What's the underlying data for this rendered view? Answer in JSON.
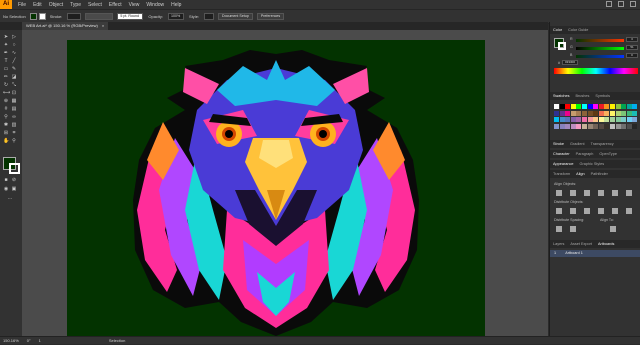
{
  "app": {
    "logo": "Ai"
  },
  "menu": {
    "items": [
      "File",
      "Edit",
      "Object",
      "Type",
      "Select",
      "Effect",
      "View",
      "Window",
      "Help"
    ]
  },
  "control_bar": {
    "selection_label": "No Selection",
    "stroke_label": "Stroke:",
    "brush_value": "5 pt. Round",
    "opacity_label": "Opacity:",
    "opacity_value": "100%",
    "style_label": "Style:",
    "document_setup": "Document Setup",
    "preferences": "Preferences",
    "fill_color": "#033300",
    "stroke_color": "#ffffff"
  },
  "document_tab": {
    "title": "WEB Art.ai* @ 150.16 % (RGB/Preview)",
    "close": "×"
  },
  "status_bar": {
    "zoom": "150.16%",
    "angle": "0°",
    "artboard_index": "1",
    "tool": "Selection"
  },
  "panels": {
    "color_tabs": [
      "Color",
      "Color Guide"
    ],
    "color_channels": [
      {
        "label": "R",
        "value": "3"
      },
      {
        "label": "G",
        "value": "51"
      },
      {
        "label": "B",
        "value": "0"
      }
    ],
    "color_hex": "033300",
    "swatch_tabs": [
      "Swatches",
      "Brushes",
      "Symbols"
    ],
    "swatch_colors": [
      "#ffffff",
      "#000000",
      "#ff0000",
      "#ffff00",
      "#00ff00",
      "#00ffff",
      "#0000ff",
      "#ff00ff",
      "#ed1c24",
      "#f7941d",
      "#fff200",
      "#8dc63f",
      "#00a651",
      "#00a99d",
      "#00aeef",
      "#2e3192",
      "#662d91",
      "#ec008c",
      "#c69c6d",
      "#a67c52",
      "#8c6239",
      "#754c24",
      "#603913",
      "#f26c4f",
      "#fbaf5d",
      "#fff568",
      "#acd373",
      "#7cc576",
      "#3bb878",
      "#1abbb4",
      "#00bff3",
      "#438cca",
      "#5674b9",
      "#8560a8",
      "#a763a8",
      "#f06eaa",
      "#f5989d",
      "#fdc689",
      "#fff799",
      "#c4df9b",
      "#a3d39c",
      "#82ca9c",
      "#7accc8",
      "#6dcff6",
      "#7da7d9",
      "#8393ca",
      "#8781bd",
      "#a187be",
      "#bd8cbf",
      "#f49ac2",
      "#c7b299",
      "#998675",
      "#736357",
      "#534741",
      "#37302a",
      "#c2c2c2",
      "#959595",
      "#707070",
      "#4d4d4d",
      "#262626"
    ],
    "stroke_tabs": [
      "Stroke",
      "Gradient",
      "Transparency"
    ],
    "char_tabs": [
      "Character",
      "Paragraph",
      "OpenType"
    ],
    "appearance_tabs": [
      "Appearance",
      "Graphic Styles"
    ],
    "align_tabs": [
      "Transform",
      "Align",
      "Pathfinder"
    ],
    "align_objects_label": "Align Objects:",
    "distribute_objects_label": "Distribute Objects:",
    "distribute_spacing_label": "Distribute Spacing:",
    "align_to_label": "Align To:",
    "layers_tabs": [
      "Layers",
      "Asset Export",
      "Artboards"
    ],
    "artboard_row": {
      "index": "1",
      "name": "Artboard 1"
    }
  }
}
